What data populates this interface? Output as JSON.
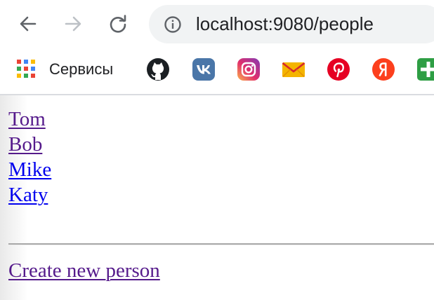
{
  "browser": {
    "url": "localhost:9080/people",
    "icons": {
      "back": "arrow-left-icon",
      "forward": "arrow-right-icon",
      "reload": "reload-icon",
      "site_info": "info-circle-icon"
    },
    "colors": {
      "nav_active": "#5f6368",
      "nav_disabled": "#bdc1c6",
      "omnibox_bg": "#f1f3f4"
    }
  },
  "bookmarks": {
    "apps_label": "Сервисы",
    "items": [
      {
        "icon": "github-icon",
        "color": "#1b1f23"
      },
      {
        "icon": "vk-icon",
        "color": "#4a76a8"
      },
      {
        "icon": "instagram-icon",
        "color": "#c13584"
      },
      {
        "icon": "mail-icon",
        "color": "#f4b400"
      },
      {
        "icon": "pinterest-icon",
        "color": "#e60023"
      },
      {
        "icon": "yandex-icon",
        "color": "#fc3f1d",
        "glyph": "Я"
      },
      {
        "icon": "plus-app-icon",
        "color": "#2e9e44"
      }
    ]
  },
  "people": [
    {
      "name": "Tom",
      "visited": true
    },
    {
      "name": "Bob",
      "visited": true
    },
    {
      "name": "Mike",
      "visited": false
    },
    {
      "name": "Katy",
      "visited": false
    }
  ],
  "create_link_label": "Create new person",
  "link_colors": {
    "visited": "#551a8b",
    "unvisited": "#0000ee"
  }
}
